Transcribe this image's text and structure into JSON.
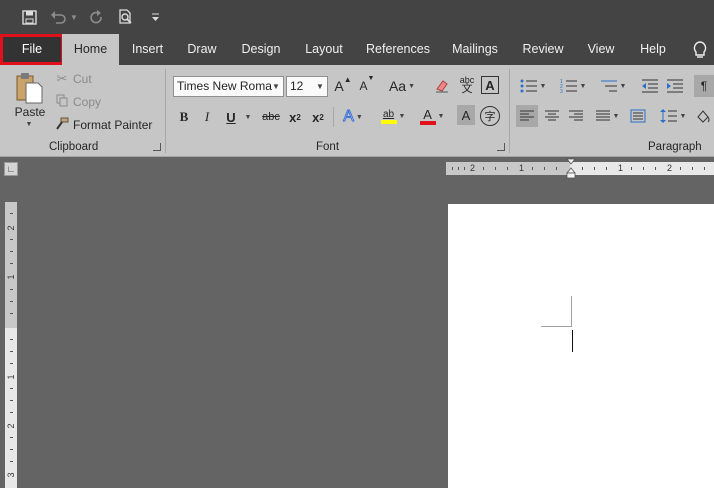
{
  "qat": {
    "save_icon": "save-icon",
    "undo_icon": "undo-icon",
    "redo_icon": "redo-icon",
    "print_preview_icon": "print-preview-icon",
    "customize_icon": "customize-qat-icon"
  },
  "tabs": [
    "File",
    "Home",
    "Insert",
    "Draw",
    "Design",
    "Layout",
    "References",
    "Mailings",
    "Review",
    "View",
    "Help"
  ],
  "active_tab": "Home",
  "highlighted_tab": "File",
  "colors": {
    "highlight_border": "#e0111a",
    "ribbon_bg": "#c6c6c6",
    "titlebar_bg": "#444444",
    "workspace_bg": "#646464",
    "highlight_color_bar": "#ffff00",
    "font_color_bar": "#e0111a"
  },
  "clipboard": {
    "paste": "Paste",
    "cut": "Cut",
    "copy": "Copy",
    "format_painter": "Format Painter",
    "label": "Clipboard"
  },
  "font": {
    "name": "Times New Roma",
    "size": "12",
    "grow": "A",
    "shrink": "A",
    "change_case": "Aa",
    "clear_format_icon": "clear-formatting-icon",
    "phonetic": "abc",
    "char_border": "A",
    "bold": "B",
    "italic": "I",
    "underline": "U",
    "strike": "abc",
    "subscript": "x",
    "subscript_suffix": "2",
    "superscript": "x",
    "superscript_suffix": "2",
    "text_effects": "A",
    "highlight": "ab",
    "font_color": "A",
    "char_shading": "A",
    "enclose": "字",
    "label": "Font"
  },
  "paragraph": {
    "label": "Paragraph"
  },
  "ruler": {
    "h_numbers": [
      "2",
      "1",
      "1",
      "2"
    ],
    "v_numbers": [
      "2",
      "1",
      "1",
      "2",
      "3"
    ]
  }
}
